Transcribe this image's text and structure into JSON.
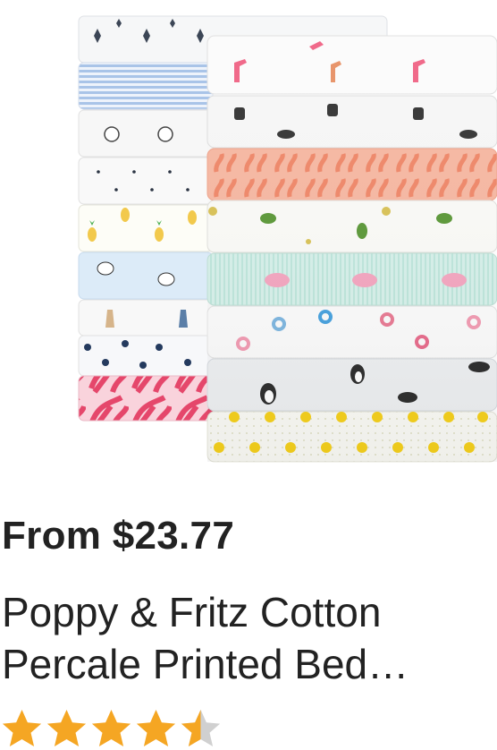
{
  "product": {
    "image_alt": "Stacked folded sheet sets with printed patterns",
    "price_text": "From $23.77",
    "title": "Poppy & Fritz Cotton Percale Printed Bed Sheets",
    "rating": {
      "value": 4.5,
      "max": 5
    }
  },
  "colors": {
    "text": "#222222",
    "star_filled": "#f5a623",
    "star_empty": "#d0d0d0",
    "sheet_base": "#f6f7f8"
  },
  "icons": [
    "star-icon"
  ]
}
